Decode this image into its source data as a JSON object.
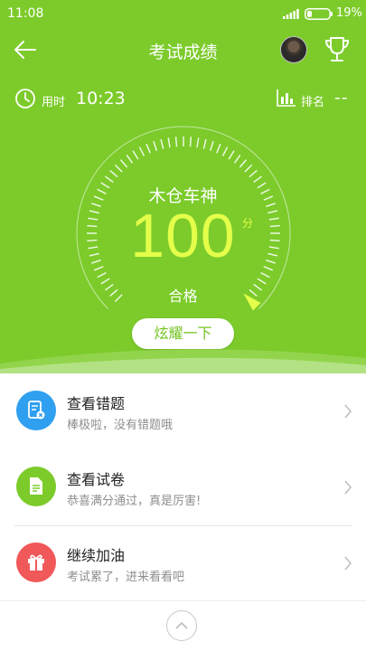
{
  "status_bar": {
    "time": "11:08",
    "battery_percent": "19%",
    "battery_level": 0.19
  },
  "header": {
    "title": "考试成绩"
  },
  "info": {
    "time_label": "用时",
    "time_value": "10:23",
    "rank_label": "排名",
    "rank_value": "--"
  },
  "result": {
    "nickname": "木仓车神",
    "score": "100",
    "score_unit": "分",
    "score_value": 100,
    "status": "合格",
    "share_label": "炫耀一下"
  },
  "actions": [
    {
      "title": "查看错题",
      "subtitle": "棒极啦，没有错题哦",
      "icon": "wrong-questions-icon",
      "color": "#2f9ff0"
    },
    {
      "title": "查看试卷",
      "subtitle": "恭喜满分通过，真是厉害!",
      "icon": "exam-paper-icon",
      "color": "#7ccb2b"
    },
    {
      "title": "继续加油",
      "subtitle": "考试累了，进来看看吧",
      "icon": "gift-icon",
      "color": "#f0585a"
    }
  ],
  "colors": {
    "primary": "#7ccb2b",
    "score": "#e4ff4a",
    "text": "#222222",
    "subtext": "#8e8e8e"
  }
}
